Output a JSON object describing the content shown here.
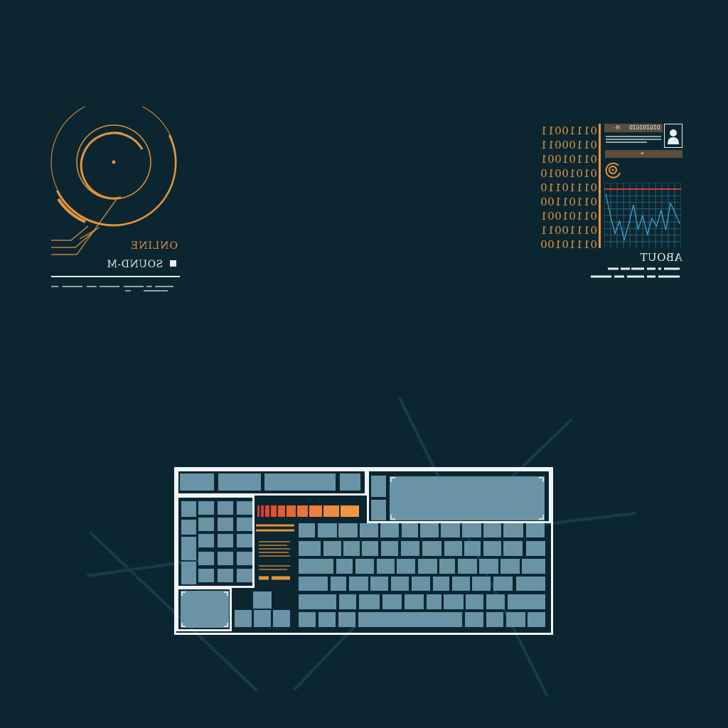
{
  "colors": {
    "background": "#0b2630",
    "accent_orange": "#e6943c",
    "key_blue": "#6a93a6",
    "frame_white": "#f1f4f5",
    "graph_line": "#3fa9d8",
    "graph_limit": "#d83a3a",
    "card_brown": "#5a4d3d"
  },
  "status_widget": {
    "status_label": "ONLINE",
    "device_name": "SOUND-M"
  },
  "info_widget": {
    "binary_rows": [
      "01110011",
      "01100011",
      "01101001",
      "01010010",
      "01110110",
      "01101100",
      "01101001",
      "01110011",
      "01110100"
    ],
    "card_header_id": "DIGIOIGID",
    "card_header_h": "H-",
    "dropdown_icon": "chevron-down-icon",
    "about_label": "ABOUT",
    "graph_values": [
      0.95,
      0.55,
      0.22,
      0.45,
      0.1,
      0.4,
      0.75,
      0.3,
      0.55,
      0.2,
      0.5,
      0.35,
      0.65,
      0.28,
      0.78,
      0.6,
      0.4
    ]
  },
  "keyboard": {
    "level_meter_segments": 10
  }
}
